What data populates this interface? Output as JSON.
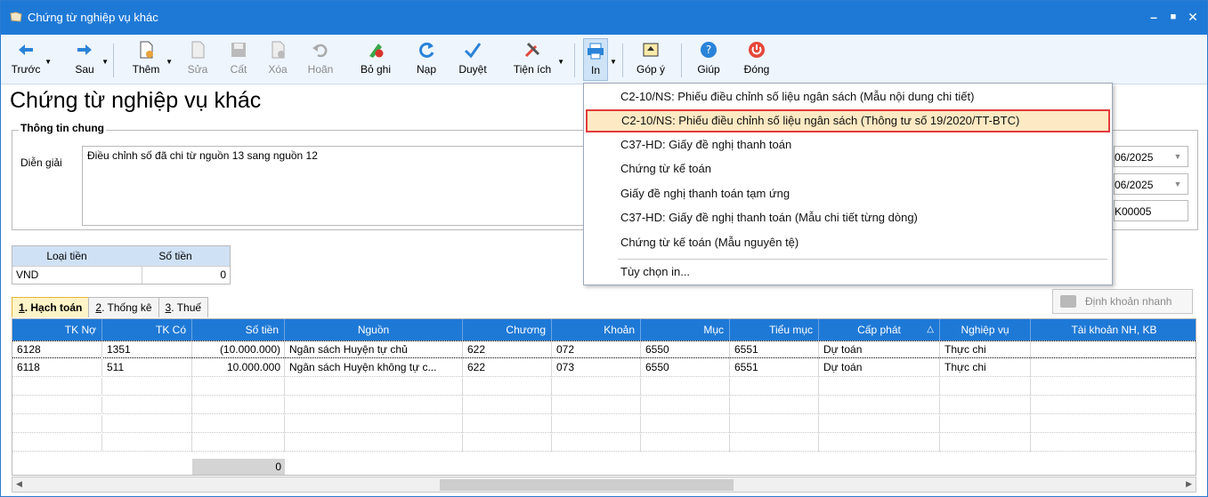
{
  "window": {
    "title": "Chứng từ nghiệp vụ khác",
    "min_glyph": "–",
    "max_glyph": "■",
    "close_glyph": "✕"
  },
  "toolbar": {
    "back": "Trước",
    "next": "Sau",
    "add": "Thêm",
    "edit": "Sửa",
    "save": "Cất",
    "delete": "Xóa",
    "undo": "Hoãn",
    "unpost": "Bỏ ghi",
    "reload": "Nạp",
    "approve": "Duyệt",
    "utilities": "Tiện ích",
    "print": "In",
    "feedback": "Góp ý",
    "help": "Giúp",
    "close": "Đóng"
  },
  "page_title": "Chứng từ nghiệp vụ khác",
  "general": {
    "legend": "Thông tin chung",
    "description_label": "Diễn giải",
    "description_value": "Điều chỉnh số đã chi từ nguồn 13 sang nguồn 12",
    "date1": "06/2025",
    "date2": "06/2025",
    "voucher_no": "K00005"
  },
  "currency": {
    "headers": [
      "Loại tiền",
      "Số tiền"
    ],
    "row": [
      "VND",
      "0"
    ]
  },
  "tabs": [
    {
      "key": "1",
      "label": ". Hạch toán"
    },
    {
      "key": "2",
      "label": ". Thống kê"
    },
    {
      "key": "3",
      "label": ". Thuế"
    }
  ],
  "quick_button": "Định khoản nhanh",
  "grid": {
    "headers": [
      "TK Nợ",
      "TK Có",
      "Số tiền",
      "Nguồn",
      "Chương",
      "Khoản",
      "Mục",
      "Tiểu mục",
      "Cấp phát",
      "Nghiệp vụ",
      "Tài khoản NH, KB"
    ],
    "sort_glyph": "△",
    "rows": [
      [
        "6128",
        "1351",
        "(10.000.000)",
        "Ngân sách Huyện tự chủ",
        "622",
        "072",
        "6550",
        "6551",
        "Dự toán",
        "Thực chi",
        ""
      ],
      [
        "6118",
        "511",
        "10.000.000",
        "Ngân sách Huyện không tự c...",
        "622",
        "073",
        "6550",
        "6551",
        "Dự toán",
        "Thực chi",
        ""
      ]
    ],
    "total": "0"
  },
  "print_menu": {
    "items": [
      "C2-10/NS: Phiếu điều chỉnh số liệu ngân sách (Mẫu nội dung chi tiết)",
      "C2-10/NS: Phiếu điều chỉnh số liệu ngân sách (Thông tư số 19/2020/TT-BTC)",
      "C37-HD: Giấy đề nghị thanh toán",
      "Chứng từ kế toán",
      "Giấy đề nghị thanh toán tạm ứng",
      "C37-HD: Giấy đề nghị thanh toán (Mẫu chi tiết từng dòng)",
      "Chứng từ kế toán (Mẫu nguyên tệ)",
      "Tùy chọn in..."
    ],
    "highlighted_index": 1
  },
  "colors": {
    "accent": "#1e79d6",
    "highlight_border": "#e23b3b",
    "highlight_fill": "#fde9c3"
  }
}
